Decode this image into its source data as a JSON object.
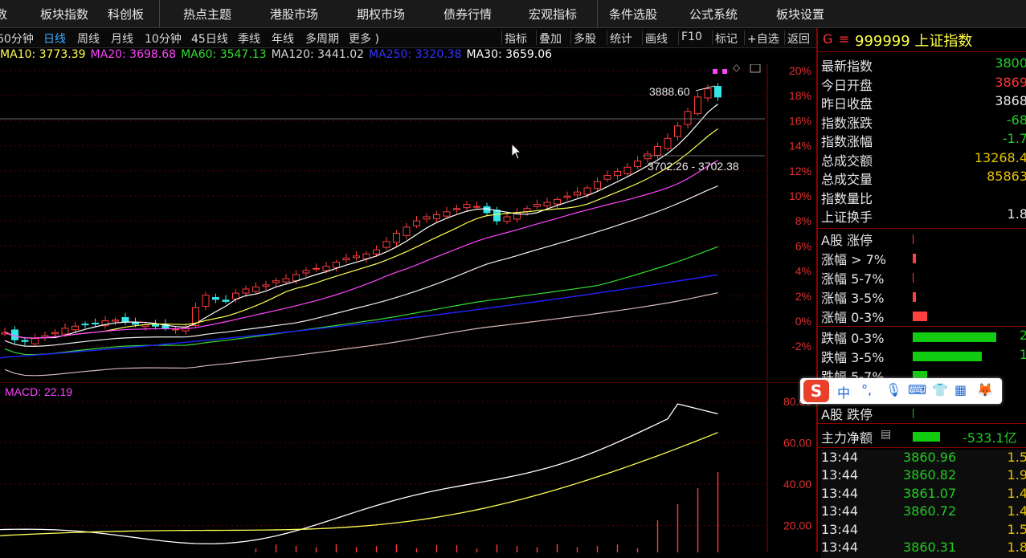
{
  "top_menu": [
    "数",
    "板块指数",
    "科创板",
    "热点主题",
    "港股市场",
    "期权市场",
    "债券行情",
    "宏观指标",
    "条件选股",
    "公式系统",
    "板块设置"
  ],
  "periods": [
    {
      "label": "60分钟",
      "active": false
    },
    {
      "label": "日线",
      "active": true
    },
    {
      "label": "周线",
      "active": false
    },
    {
      "label": "月线",
      "active": false
    },
    {
      "label": "10分钟",
      "active": false
    },
    {
      "label": "45日线",
      "active": false
    },
    {
      "label": "季线",
      "active": false
    },
    {
      "label": "年线",
      "active": false
    },
    {
      "label": "多周期",
      "active": false
    },
    {
      "label": "更多 )",
      "active": false
    }
  ],
  "tools": [
    "指标",
    "叠加",
    "多股",
    "统计",
    "画线",
    "F10",
    "标记",
    "+自选",
    "返回"
  ],
  "ma": [
    {
      "label": "MA10: 3773.39",
      "color": "#ffff55"
    },
    {
      "label": "MA20: 3698.68",
      "color": "#ff44ff"
    },
    {
      "label": "MA60: 3547.13",
      "color": "#33dd33"
    },
    {
      "label": "MA120: 3441.02",
      "color": "#d8d8d8"
    },
    {
      "label": "MA250: 3320.38",
      "color": "#3333ff"
    },
    {
      "label": "MA30: 3659.06",
      "color": "#ffffff"
    }
  ],
  "chart_data": {
    "type": "candlestick",
    "pct_axis": [
      "20%",
      "18%",
      "16%",
      "14%",
      "12%",
      "10%",
      "8%",
      "6%",
      "4%",
      "2%",
      "0%",
      "-2%"
    ],
    "high_label": "3888.60",
    "cursor_label": "3702.26 - 3702.38",
    "macd_label": "MACD: 22.19",
    "macd_axis": [
      "80.00",
      "60.00",
      "40.00",
      "20.00"
    ],
    "closes": [
      3290,
      3272,
      3268,
      3275,
      3282,
      3290,
      3300,
      3305,
      3310,
      3312,
      3318,
      3320,
      3315,
      3310,
      3308,
      3305,
      3300,
      3298,
      3302,
      3350,
      3380,
      3370,
      3365,
      3385,
      3395,
      3400,
      3405,
      3415,
      3420,
      3430,
      3440,
      3445,
      3450,
      3460,
      3470,
      3475,
      3480,
      3490,
      3510,
      3530,
      3545,
      3560,
      3570,
      3575,
      3582,
      3590,
      3600,
      3595,
      3580,
      3560,
      3570,
      3580,
      3590,
      3600,
      3605,
      3612,
      3620,
      3630,
      3640,
      3655,
      3670,
      3680,
      3690,
      3705,
      3722,
      3740,
      3760,
      3790,
      3825,
      3860,
      3880,
      3860
    ]
  },
  "right_panel": {
    "title_code": "999999 上证指数",
    "rows": [
      {
        "label": "最新指数",
        "value": "3800",
        "color": "#22cc22"
      },
      {
        "label": "今日开盘",
        "value": "3869",
        "color": "#ff3333"
      },
      {
        "label": "昨日收盘",
        "value": "3868",
        "color": "#e6e6e6"
      },
      {
        "label": "指数涨跌",
        "value": "-68",
        "color": "#22cc22"
      },
      {
        "label": "指数涨幅",
        "value": "-1.7",
        "color": "#22cc22"
      },
      {
        "label": "总成交额",
        "value": "13268.4",
        "color": "#e6c200"
      },
      {
        "label": "总成交量",
        "value": "85863",
        "color": "#e6c200"
      },
      {
        "label": "指数量比",
        "value": "",
        "color": "#e6e6e6"
      },
      {
        "label": "上证换手",
        "value": "1.8",
        "color": "#e6e6e6"
      }
    ],
    "up_rows": [
      {
        "label": "A股 涨停",
        "fraction": 0.0
      },
      {
        "label": "涨幅 > 7%",
        "fraction": 0.02
      },
      {
        "label": "涨幅 5-7%",
        "fraction": 0.0
      },
      {
        "label": "涨幅 3-5%",
        "fraction": 0.02
      },
      {
        "label": "涨幅 0-3%",
        "fraction": 0.09
      }
    ],
    "down_rows": [
      {
        "label": "跌幅 0-3%",
        "value": "2",
        "fraction": 0.52
      },
      {
        "label": "跌幅 3-5%",
        "value": "1",
        "fraction": 0.43
      },
      {
        "label": "跌幅 5-7%",
        "value": "",
        "fraction": 0.09
      }
    ],
    "limit_down": "A股 跌停",
    "main_net_label": "主力净额",
    "main_net_value": "-533.1亿",
    "ticks": [
      {
        "time": "13:44",
        "price": "3860.96",
        "vol": "1.5"
      },
      {
        "time": "13:44",
        "price": "3860.82",
        "vol": "1.9"
      },
      {
        "time": "13:44",
        "price": "3861.07",
        "vol": "1.4"
      },
      {
        "time": "13:44",
        "price": "3860.72",
        "vol": "1.4"
      },
      {
        "time": "13:44",
        "price": "",
        "vol": "1.5"
      },
      {
        "time": "13:44",
        "price": "3860.31",
        "vol": "1.8"
      }
    ]
  },
  "ime": {
    "mode": "中"
  }
}
